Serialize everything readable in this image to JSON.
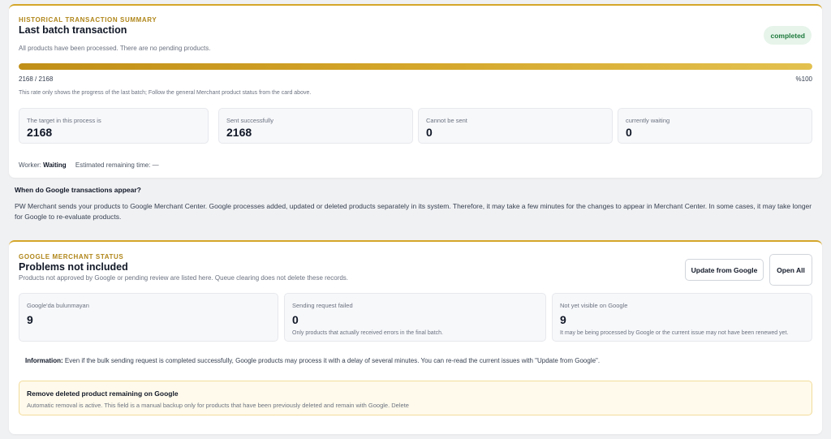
{
  "batch": {
    "eyebrow": "HISTORICAL TRANSACTION SUMMARY",
    "title": "Last batch transaction",
    "subtitle": "All products have been processed. There are no pending products.",
    "status": "completed",
    "progress": {
      "fraction": 1.0,
      "count_label": "2168 / 2168",
      "percent_label": "%100"
    },
    "progress_note": "This rate only shows the progress of the last batch; Follow the general Merchant product status from the card above.",
    "stats": [
      {
        "label": "The target in this process is",
        "value": "2168"
      },
      {
        "label": "Sent successfully",
        "value": "2168"
      },
      {
        "label": "Cannot be sent",
        "value": "0"
      },
      {
        "label": "currently waiting",
        "value": "0"
      }
    ],
    "worker_label": "Worker:",
    "worker_status": "Waiting",
    "remaining_label": "Estimated remaining time: —"
  },
  "info": {
    "question": "When do Google transactions appear?",
    "body": "PW Merchant sends your products to Google Merchant Center. Google processes added, updated or deleted products separately in its system. Therefore, it may take a few minutes for the changes to appear in Merchant Center. In some cases, it may take longer for Google to re-evaluate products."
  },
  "merchant": {
    "eyebrow": "GOOGLE MERCHANT STATUS",
    "title": "Problems not included",
    "subtitle": "Products not approved by Google or pending review are listed here. Queue clearing does not delete these records.",
    "update_button": "Update from Google",
    "open_all_button": "Open All",
    "stats": [
      {
        "label": "Google'da bulunmayan",
        "value": "9",
        "note": ""
      },
      {
        "label": "Sending request failed",
        "value": "0",
        "note": "Only products that actually received errors in the final batch."
      },
      {
        "label": "Not yet visible on Google",
        "value": "9",
        "note": "It may be being processed by Google or the current issue may not have been renewed yet."
      }
    ],
    "info_label": "Information:",
    "info_text": "Even if the bulk sending request is completed successfully, Google products may process it with a delay of several minutes. You can re-read the current issues with \"Update from Google\".",
    "warning_title": "Remove deleted product remaining on Google",
    "warning_text": "Automatic removal is active. This field is a manual backup only for products that have been previously deleted and remain with Google. Delete"
  }
}
